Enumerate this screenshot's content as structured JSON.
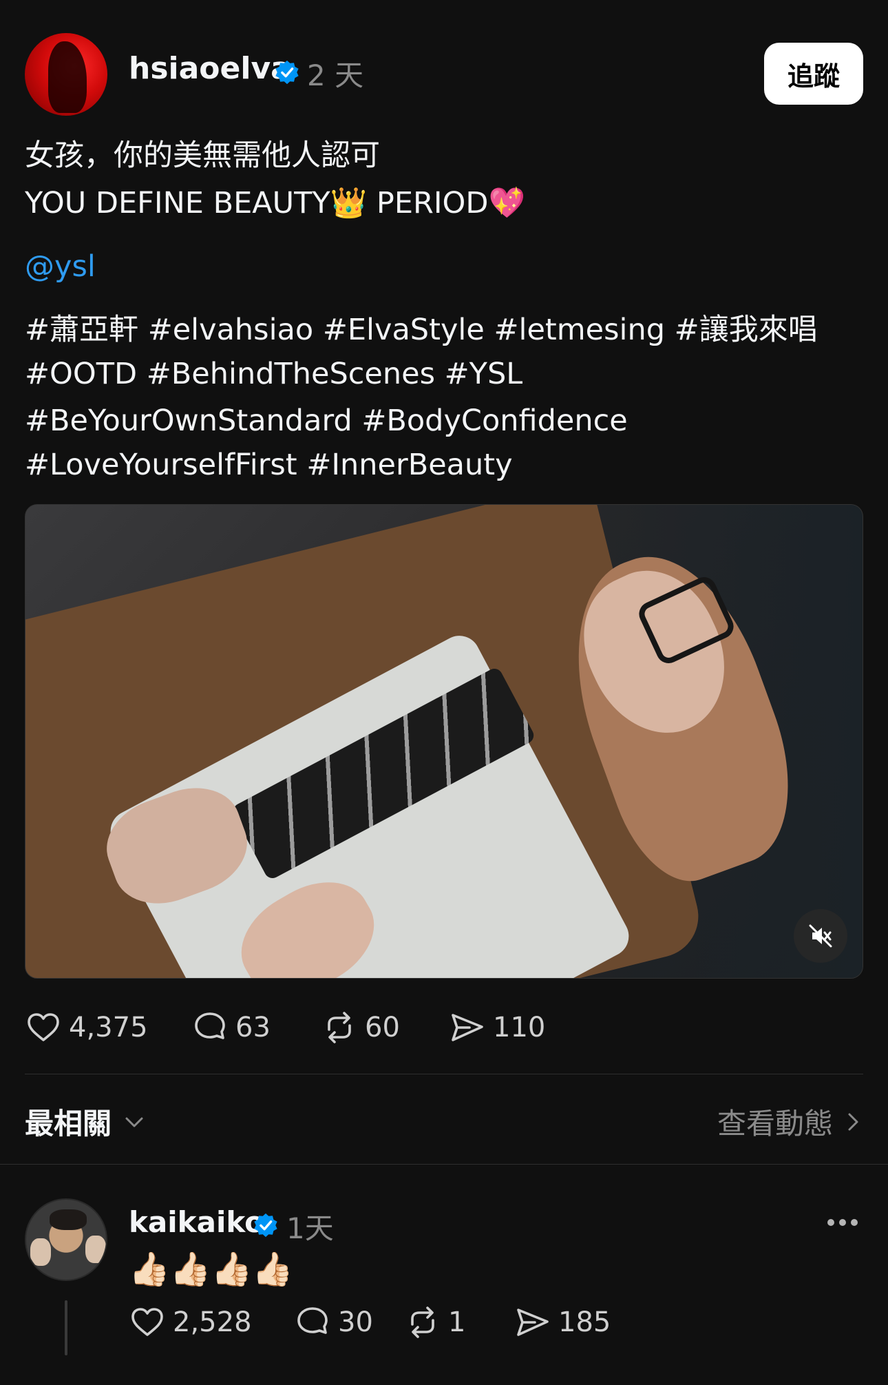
{
  "post": {
    "username": "hsiaoelva",
    "time": "2 天",
    "follow_label": "追蹤",
    "caption_line1": "女孩，你的美無需他人認可",
    "caption_line2": "YOU DEFINE BEAUTY👑 PERIOD💖",
    "mention": "@ysl",
    "hashtags_line1": "#蕭亞軒 #elvahsiao #ElvaStyle #letmesing #讓我來唱",
    "hashtags_line2": "#OOTD #BehindTheScenes #YSL",
    "hashtags_line3": "#BeYourOwnStandard #BodyConfidence",
    "hashtags_line4": "#LoveYourselfFirst #InnerBeauty",
    "likes": "4,375",
    "comments": "63",
    "reposts": "60",
    "shares": "110"
  },
  "replies_bar": {
    "sort_label": "最相關",
    "view_activity_label": "查看動態"
  },
  "reply": {
    "username": "kaikaiko",
    "time": "1天",
    "text": "👍🏻👍🏻👍🏻👍🏻",
    "likes": "2,528",
    "comments": "30",
    "reposts": "1",
    "shares": "185"
  },
  "colors": {
    "background": "#101010",
    "accent_link": "#2f9bf0",
    "verified": "#0095f6"
  },
  "icons": [
    "heart-icon",
    "comment-icon",
    "repost-icon",
    "share-icon",
    "verified-badge-icon",
    "mute-icon",
    "chevron-down-icon",
    "chevron-right-icon",
    "more-icon"
  ]
}
